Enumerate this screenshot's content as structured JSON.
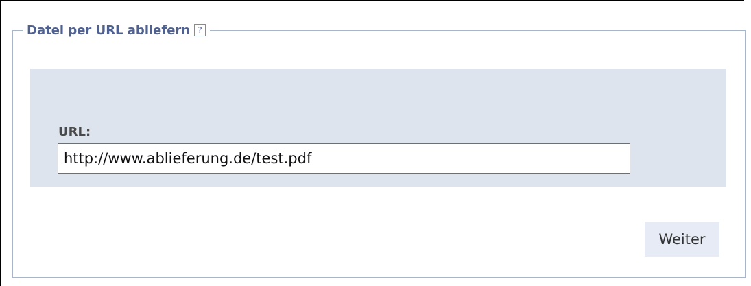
{
  "section": {
    "title": "Datei per URL abliefern",
    "help_icon_symbol": "?"
  },
  "form": {
    "url_label": "URL:",
    "url_value": "http://www.ablieferung.de/test.pdf"
  },
  "actions": {
    "next_label": "Weiter"
  },
  "colors": {
    "title": "#4f6190",
    "panel_background": "#dee4ee",
    "border": "#a9b4c9",
    "button_background": "#e6ebf5"
  }
}
